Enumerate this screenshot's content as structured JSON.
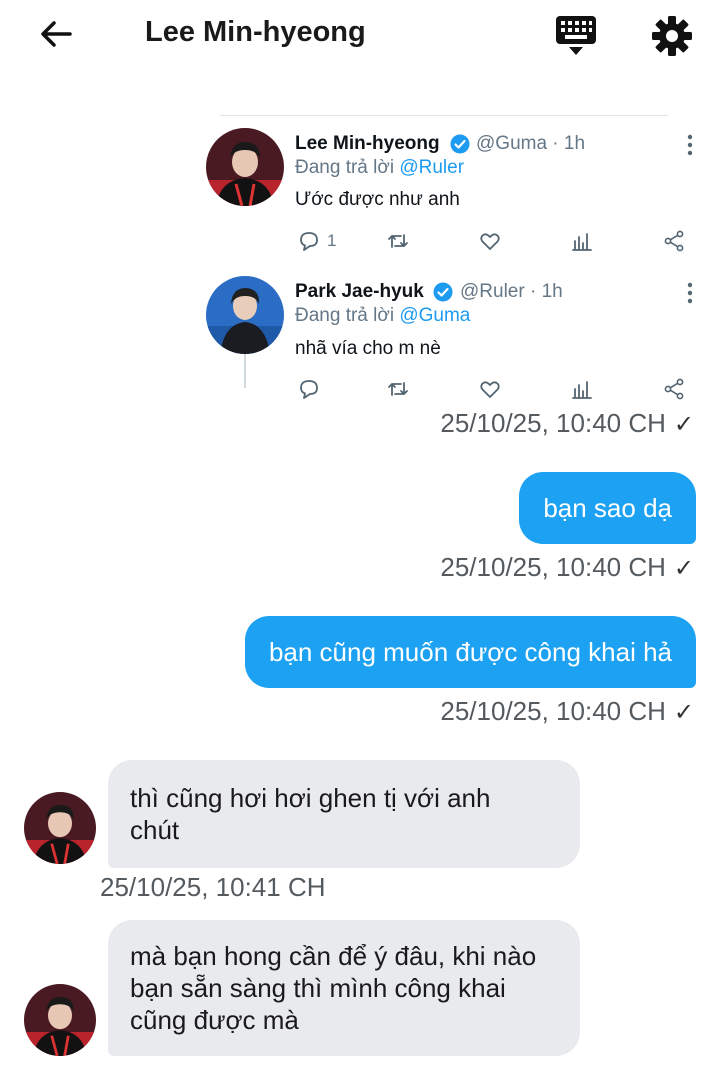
{
  "header": {
    "title": "Lee Min-hyeong",
    "back_icon": "arrow-left-icon",
    "keyboard_icon": "keyboard-icon",
    "settings_icon": "gear-icon"
  },
  "tweet_card": {
    "tweets": [
      {
        "name": "Lee Min-hyeong",
        "handle": "@Guma · 1h",
        "reply_prefix": "Đang trả lời ",
        "reply_to": "@Ruler",
        "body": "Ước được như anh",
        "reply_count": "1"
      },
      {
        "name": "Park Jae-hyuk",
        "handle": "@Ruler · 1h",
        "reply_prefix": "Đang trả lời ",
        "reply_to": "@Guma",
        "body": "nhã vía cho m nè",
        "reply_count": ""
      }
    ]
  },
  "messages": [
    {
      "direction": "out",
      "kind": "tweet-share",
      "timestamp": "25/10/25, 10:40 CH",
      "status": "✓"
    },
    {
      "direction": "out",
      "text": "bạn sao dạ",
      "timestamp": "25/10/25, 10:40 CH",
      "status": "✓"
    },
    {
      "direction": "out",
      "text": "bạn cũng muốn được công khai hả",
      "timestamp": "25/10/25, 10:40 CH",
      "status": "✓"
    },
    {
      "direction": "in",
      "text_lines": [
        "thì cũng hơi hơi ghen tị với anh",
        "chút"
      ],
      "timestamp": "25/10/25, 10:41 CH"
    },
    {
      "direction": "in",
      "text_lines": [
        "mà bạn hong cần để ý đâu, khi nào",
        "bạn sẵn sàng thì mình công khai",
        "cũng được mà"
      ]
    }
  ],
  "colors": {
    "accent": "#1da1f2",
    "incoming_bubble": "#e8eaed",
    "timestamp": "#555a5e",
    "mention": "#1d9bf0"
  }
}
